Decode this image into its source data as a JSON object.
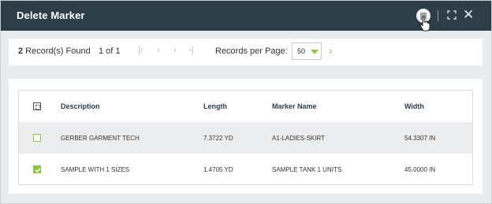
{
  "dialog": {
    "title": "Delete Marker",
    "icons": [
      "trash-icon",
      "expand-icon",
      "close-icon"
    ],
    "close_glyph": "✕"
  },
  "pager": {
    "count": "2",
    "count_suffix": " Record(s) Found",
    "pages": "1 of 1",
    "first": "|‹",
    "prev": "‹",
    "next": "›",
    "last": "›|",
    "rpp_label": "Records per Page:",
    "rpp_value": "50",
    "next_green": "›"
  },
  "table": {
    "headers": [
      "Description",
      "Length",
      "Marker Name",
      "Width"
    ],
    "rows": [
      {
        "checked": false,
        "description": "GERBER GARMENT TECH",
        "length": "7.3722 YD",
        "marker_name": "A1-LADIES-SKIRT",
        "width": "54.3307 IN"
      },
      {
        "checked": true,
        "description": "SAMPLE WITH 1 SIZES",
        "length": "1.4705 YD",
        "marker_name": "SAMPLE TANK 1 UNITS",
        "width": "45.0000 IN"
      }
    ]
  },
  "colors": {
    "titlebar": "#2d3e48",
    "accent_green": "#8cc63f"
  }
}
